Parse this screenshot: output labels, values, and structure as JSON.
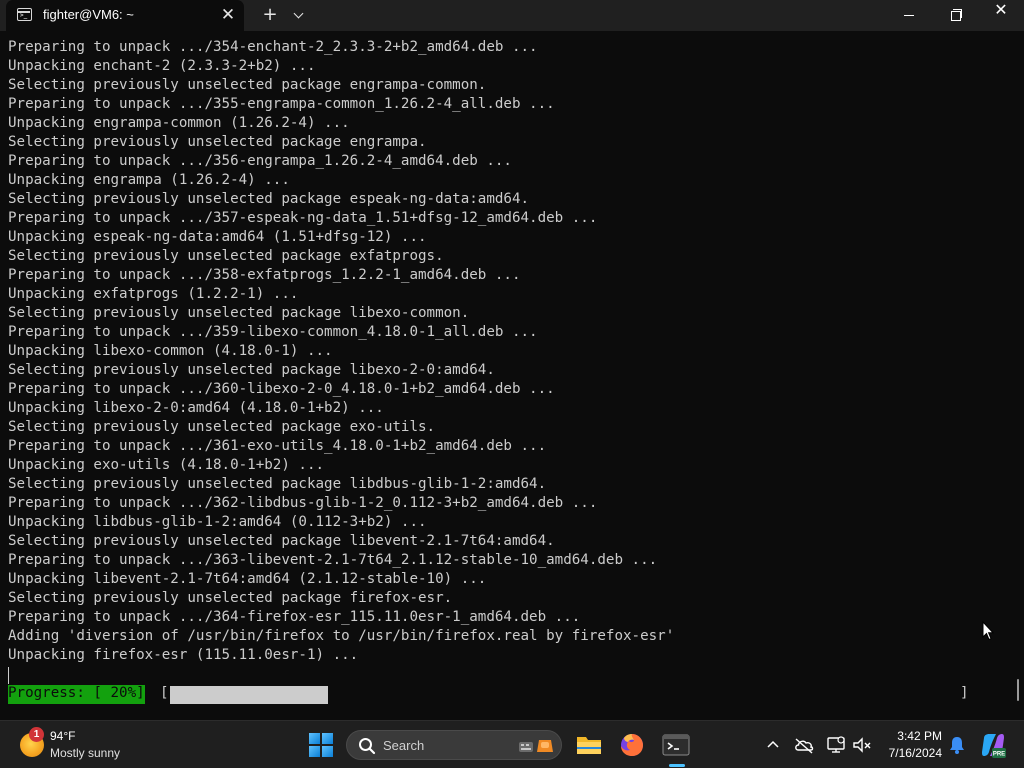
{
  "window": {
    "tab_title": "fighter@VM6: ~",
    "tab_close": "✕",
    "new_tab": "+",
    "close_glyph": "✕"
  },
  "terminal": {
    "lines": [
      "Preparing to unpack .../354-enchant-2_2.3.3-2+b2_amd64.deb ...",
      "Unpacking enchant-2 (2.3.3-2+b2) ...",
      "Selecting previously unselected package engrampa-common.",
      "Preparing to unpack .../355-engrampa-common_1.26.2-4_all.deb ...",
      "Unpacking engrampa-common (1.26.2-4) ...",
      "Selecting previously unselected package engrampa.",
      "Preparing to unpack .../356-engrampa_1.26.2-4_amd64.deb ...",
      "Unpacking engrampa (1.26.2-4) ...",
      "Selecting previously unselected package espeak-ng-data:amd64.",
      "Preparing to unpack .../357-espeak-ng-data_1.51+dfsg-12_amd64.deb ...",
      "Unpacking espeak-ng-data:amd64 (1.51+dfsg-12) ...",
      "Selecting previously unselected package exfatprogs.",
      "Preparing to unpack .../358-exfatprogs_1.2.2-1_amd64.deb ...",
      "Unpacking exfatprogs (1.2.2-1) ...",
      "Selecting previously unselected package libexo-common.",
      "Preparing to unpack .../359-libexo-common_4.18.0-1_all.deb ...",
      "Unpacking libexo-common (4.18.0-1) ...",
      "Selecting previously unselected package libexo-2-0:amd64.",
      "Preparing to unpack .../360-libexo-2-0_4.18.0-1+b2_amd64.deb ...",
      "Unpacking libexo-2-0:amd64 (4.18.0-1+b2) ...",
      "Selecting previously unselected package exo-utils.",
      "Preparing to unpack .../361-exo-utils_4.18.0-1+b2_amd64.deb ...",
      "Unpacking exo-utils (4.18.0-1+b2) ...",
      "Selecting previously unselected package libdbus-glib-1-2:amd64.",
      "Preparing to unpack .../362-libdbus-glib-1-2_0.112-3+b2_amd64.deb ...",
      "Unpacking libdbus-glib-1-2:amd64 (0.112-3+b2) ...",
      "Selecting previously unselected package libevent-2.1-7t64:amd64.",
      "Preparing to unpack .../363-libevent-2.1-7t64_2.1.12-stable-10_amd64.deb ...",
      "Unpacking libevent-2.1-7t64:amd64 (2.1.12-stable-10) ...",
      "Selecting previously unselected package firefox-esr.",
      "Preparing to unpack .../364-firefox-esr_115.11.0esr-1_amd64.deb ...",
      "Adding 'diversion of /usr/bin/firefox to /usr/bin/firefox.real by firefox-esr'",
      "Unpacking firefox-esr (115.11.0esr-1) ..."
    ],
    "progress_label": "Progress: [ 20%]",
    "progress_open": "[",
    "progress_close": "]",
    "progress_fraction": 0.2
  },
  "taskbar": {
    "weather_badge": "1",
    "weather_temp": "94°F",
    "weather_desc": "Mostly sunny",
    "search_placeholder": "Search",
    "clock_time": "3:42 PM",
    "clock_date": "7/16/2024",
    "apps": [
      "file-explorer-icon",
      "firefox-icon",
      "terminal-icon"
    ]
  },
  "colors": {
    "terminal_bg": "#0c0c0c",
    "terminal_fg": "#cccccc",
    "progress_green": "#13a10e",
    "accent": "#4cc2ff"
  }
}
